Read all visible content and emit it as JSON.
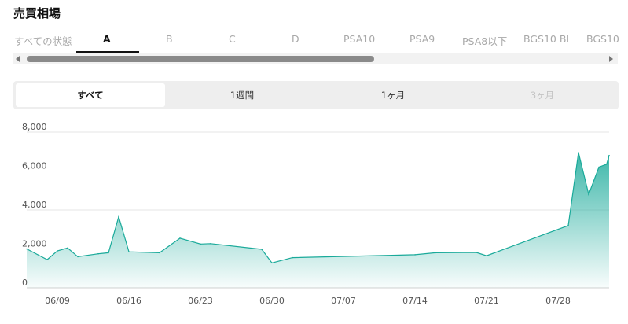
{
  "section_title": "売買相場",
  "grade_tabs": [
    {
      "label": "すべての状態",
      "active": false
    },
    {
      "label": "A",
      "active": true
    },
    {
      "label": "B",
      "active": false
    },
    {
      "label": "C",
      "active": false
    },
    {
      "label": "D",
      "active": false
    },
    {
      "label": "PSA10",
      "active": false
    },
    {
      "label": "PSA9",
      "active": false
    },
    {
      "label": "PSA8以下",
      "active": false
    },
    {
      "label": "BGS10 BL",
      "active": false
    },
    {
      "label": "BGS10",
      "active": false
    }
  ],
  "period_tabs": [
    {
      "label": "すべて",
      "state": "active"
    },
    {
      "label": "1週間",
      "state": "normal"
    },
    {
      "label": "1ヶ月",
      "state": "normal"
    },
    {
      "label": "3ヶ月",
      "state": "disabled"
    }
  ],
  "colors": {
    "line": "#1aaa9a",
    "fill_top": "#1aaa9a",
    "grid": "#e6e6e6"
  },
  "chart_data": {
    "type": "area",
    "title": "",
    "xlabel": "",
    "ylabel": "",
    "ylim": [
      0,
      8000
    ],
    "yticks": [
      "0",
      "2,000",
      "4,000",
      "6,000",
      "8,000"
    ],
    "ytick_values": [
      0,
      2000,
      4000,
      6000,
      8000
    ],
    "xticks": [
      "06/09",
      "06/16",
      "06/23",
      "06/30",
      "07/07",
      "07/14",
      "07/21",
      "07/28"
    ],
    "xtick_values": [
      "2024-06-09",
      "2024-06-16",
      "2024-06-23",
      "2024-06-30",
      "2024-07-07",
      "2024-07-14",
      "2024-07-21",
      "2024-07-28"
    ],
    "xlim": [
      "2024-06-06",
      "2024-08-02"
    ],
    "grid": true,
    "series": [
      {
        "x": [
          "2024-06-06",
          "2024-06-08",
          "2024-06-09",
          "2024-06-10",
          "2024-06-11",
          "2024-06-13",
          "2024-06-14",
          "2024-06-15",
          "2024-06-16",
          "2024-06-19",
          "2024-06-21",
          "2024-06-23",
          "2024-06-24",
          "2024-06-29",
          "2024-06-30",
          "2024-07-02",
          "2024-07-14",
          "2024-07-16",
          "2024-07-20",
          "2024-07-21",
          "2024-07-29",
          "2024-07-30",
          "2024-07-31",
          "2024-08-01",
          "2024-08-01T18:00",
          "2024-08-02"
        ],
        "values": [
          2000,
          1450,
          1900,
          2050,
          1600,
          1750,
          1800,
          3650,
          1850,
          1800,
          2550,
          2250,
          2270,
          1980,
          1280,
          1550,
          1700,
          1800,
          1820,
          1650,
          3200,
          6950,
          4800,
          6200,
          6350,
          6800
        ]
      }
    ]
  }
}
